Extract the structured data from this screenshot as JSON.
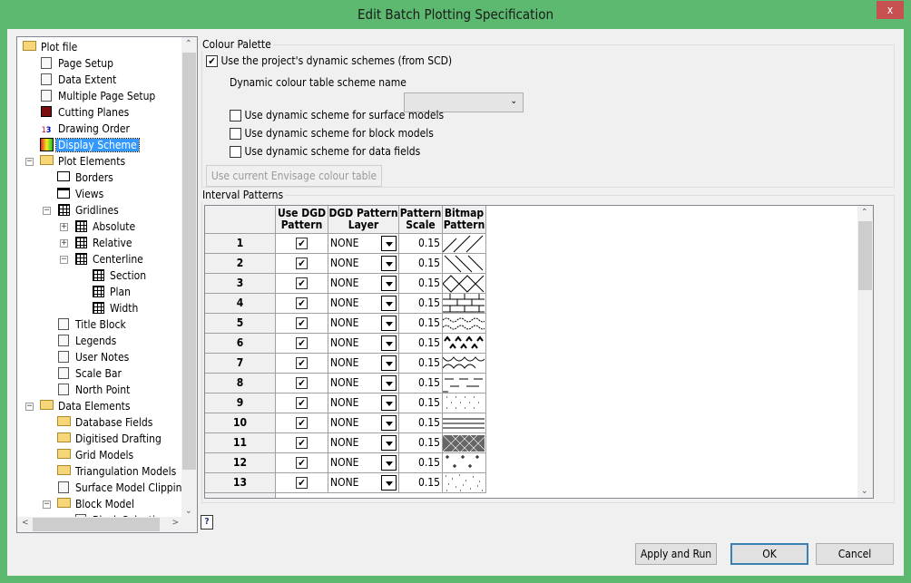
{
  "window": {
    "title": "Edit Batch Plotting Specification",
    "close_label": "x"
  },
  "tree": [
    {
      "label": "Plot file",
      "level": 0,
      "icon": "folder-icon",
      "expander": ""
    },
    {
      "label": "Page Setup",
      "level": 1,
      "icon": "page-setup-icon"
    },
    {
      "label": "Data Extent",
      "level": 1,
      "icon": "data-extent-icon"
    },
    {
      "label": "Multiple Page Setup",
      "level": 1,
      "icon": "multiple-page-icon"
    },
    {
      "label": "Cutting Planes",
      "level": 1,
      "icon": "cube-icon"
    },
    {
      "label": "Drawing Order",
      "level": 1,
      "icon": "numbers-icon"
    },
    {
      "label": "Display Scheme",
      "level": 1,
      "icon": "colour-grid-icon",
      "selected": true
    },
    {
      "label": "Plot Elements",
      "level": 1,
      "icon": "folder-icon",
      "expander": "-"
    },
    {
      "label": "Borders",
      "level": 2,
      "icon": "border-icon"
    },
    {
      "label": "Views",
      "level": 2,
      "icon": "views-icon"
    },
    {
      "label": "Gridlines",
      "level": 2,
      "icon": "grid-icon",
      "expander": "-"
    },
    {
      "label": "Absolute",
      "level": 3,
      "icon": "grid-icon",
      "expander": "+"
    },
    {
      "label": "Relative",
      "level": 3,
      "icon": "grid-icon",
      "expander": "+"
    },
    {
      "label": "Centerline",
      "level": 3,
      "icon": "grid-icon",
      "expander": "-"
    },
    {
      "label": "Section",
      "level": 4,
      "icon": "grid-icon"
    },
    {
      "label": "Plan",
      "level": 4,
      "icon": "grid-icon"
    },
    {
      "label": "Width",
      "level": 4,
      "icon": "grid-icon"
    },
    {
      "label": "Title Block",
      "level": 2,
      "icon": "title-block-icon"
    },
    {
      "label": "Legends",
      "level": 2,
      "icon": "legend-icon"
    },
    {
      "label": "User Notes",
      "level": 2,
      "icon": "note-icon"
    },
    {
      "label": "Scale Bar",
      "level": 2,
      "icon": "scale-bar-icon"
    },
    {
      "label": "North Point",
      "level": 2,
      "icon": "north-point-icon"
    },
    {
      "label": "Data Elements",
      "level": 1,
      "icon": "folder-icon",
      "expander": "-"
    },
    {
      "label": "Database Fields",
      "level": 2,
      "icon": "folder-database-icon"
    },
    {
      "label": "Digitised Drafting",
      "level": 2,
      "icon": "folder-drafting-icon"
    },
    {
      "label": "Grid Models",
      "level": 2,
      "icon": "folder-grid-icon"
    },
    {
      "label": "Triangulation Models",
      "level": 2,
      "icon": "folder-triangle-icon"
    },
    {
      "label": "Surface Model Clipping",
      "level": 2,
      "icon": "clipping-icon"
    },
    {
      "label": "Block Model",
      "level": 2,
      "icon": "folder-block-icon",
      "expander": "-"
    },
    {
      "label": "Block Selection",
      "level": 3,
      "icon": "block-selection-icon"
    }
  ],
  "colour_palette": {
    "legend": "Colour Palette",
    "use_dynamic": {
      "label": "Use the project's dynamic schemes (from SCD)",
      "checked": true
    },
    "scheme_name_label": "Dynamic colour table scheme name",
    "scheme_name_value": "",
    "options": [
      {
        "label": "Use dynamic scheme for surface models",
        "checked": false
      },
      {
        "label": "Use dynamic scheme for block models",
        "checked": false
      },
      {
        "label": "Use dynamic scheme for data fields",
        "checked": false
      }
    ],
    "envisage_button": "Use current Envisage colour table"
  },
  "interval_patterns": {
    "legend": "Interval Patterns",
    "columns": [
      [
        "Use DGD",
        "Pattern"
      ],
      [
        "DGD Pattern",
        "Layer"
      ],
      [
        "Pattern",
        "Scale"
      ],
      [
        "Bitmap",
        "Pattern"
      ]
    ],
    "rows": [
      {
        "n": "1",
        "use": true,
        "layer": "NONE",
        "scale": "0.15",
        "pattern": "forward-diagonal"
      },
      {
        "n": "2",
        "use": true,
        "layer": "NONE",
        "scale": "0.15",
        "pattern": "back-diagonal"
      },
      {
        "n": "3",
        "use": true,
        "layer": "NONE",
        "scale": "0.15",
        "pattern": "diamond"
      },
      {
        "n": "4",
        "use": true,
        "layer": "NONE",
        "scale": "0.15",
        "pattern": "brick"
      },
      {
        "n": "5",
        "use": true,
        "layer": "NONE",
        "scale": "0.15",
        "pattern": "waves"
      },
      {
        "n": "6",
        "use": true,
        "layer": "NONE",
        "scale": "0.15",
        "pattern": "grass"
      },
      {
        "n": "7",
        "use": true,
        "layer": "NONE",
        "scale": "0.15",
        "pattern": "arcs"
      },
      {
        "n": "8",
        "use": true,
        "layer": "NONE",
        "scale": "0.15",
        "pattern": "dashes"
      },
      {
        "n": "9",
        "use": true,
        "layer": "NONE",
        "scale": "0.15",
        "pattern": "dots"
      },
      {
        "n": "10",
        "use": true,
        "layer": "NONE",
        "scale": "0.15",
        "pattern": "horizontal-lines"
      },
      {
        "n": "11",
        "use": true,
        "layer": "NONE",
        "scale": "0.15",
        "pattern": "crosshatch"
      },
      {
        "n": "12",
        "use": true,
        "layer": "NONE",
        "scale": "0.15",
        "pattern": "plus"
      },
      {
        "n": "13",
        "use": true,
        "layer": "NONE",
        "scale": "0.15",
        "pattern": "speckle"
      }
    ]
  },
  "buttons": {
    "apply_run": "Apply and Run",
    "ok": "OK",
    "cancel": "Cancel"
  },
  "colors": {
    "titlebar": "#5cb96f",
    "selection": "#3399ff",
    "close": "#c75050"
  }
}
